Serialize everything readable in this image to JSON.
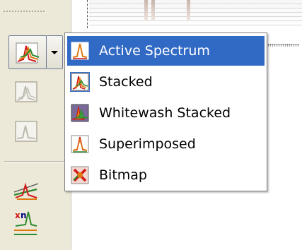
{
  "menu": {
    "items": [
      {
        "label": "Active Spectrum",
        "icon": "single-peak-icon",
        "selected": true,
        "checked": false
      },
      {
        "label": "Stacked",
        "icon": "stacked-spectra-icon",
        "selected": false,
        "checked": true
      },
      {
        "label": "Whitewash Stacked",
        "icon": "whitewash-stacked-icon",
        "selected": false,
        "checked": false
      },
      {
        "label": "Superimposed",
        "icon": "superimposed-icon",
        "selected": false,
        "checked": false
      },
      {
        "label": "Bitmap",
        "icon": "bitmap-icon",
        "selected": false,
        "checked": false
      }
    ]
  },
  "toolbar": {
    "buttons": [
      {
        "icon": "stacked-spectra-icon",
        "active": true
      },
      {
        "icon": "stacked-spectra-icon",
        "active": false
      },
      {
        "icon": "single-peak-icon",
        "active": false
      },
      {
        "icon": "peak-fit-icon",
        "active": true
      },
      {
        "icon": "multiplot-xn-icon",
        "active": true
      }
    ]
  },
  "colors": {
    "selection": "#316ac5",
    "toolbar_bg": "#ece9d8",
    "peak_orange": "#e07a10",
    "peak_red": "#d01818",
    "peak_green": "#2e8a2e"
  }
}
